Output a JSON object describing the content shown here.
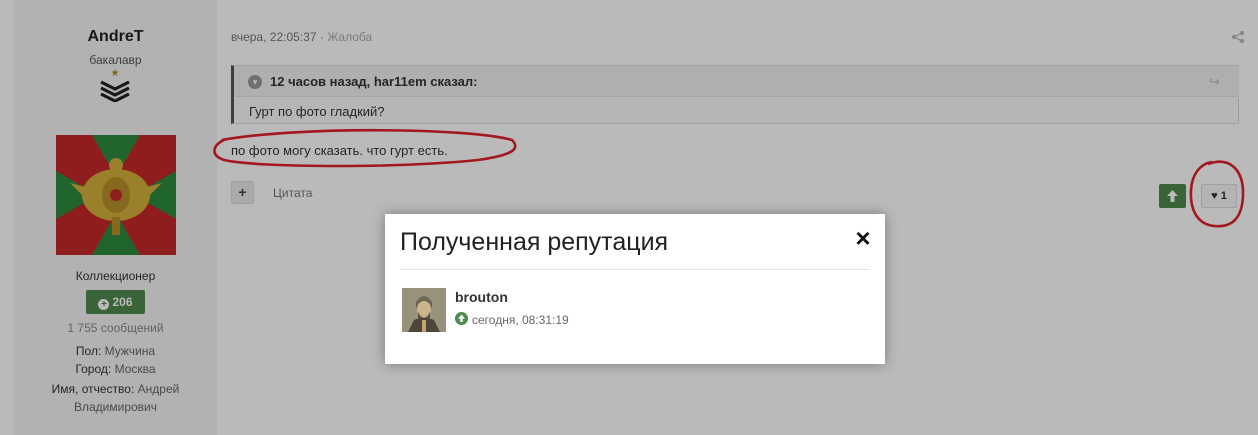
{
  "author": {
    "name": "AndreT",
    "rank": "бакалавр",
    "group": "Коллекционер",
    "reputation": "206",
    "posts": "1 755 сообщений",
    "fields": [
      {
        "label": "Пол:",
        "value": "Мужчина"
      },
      {
        "label": "Город:",
        "value": "Москва"
      },
      {
        "label": "Имя, отчество:",
        "value": "Андрей Владимирович"
      }
    ]
  },
  "post": {
    "date": "вчера, 22:05:37",
    "separator": "·",
    "report_label": "Жалоба",
    "quote": {
      "citation": "12 часов назад, har11em сказал:",
      "text": "Гурт по фото гладкий?"
    },
    "text": "по фото могу сказать. что гурт есть.",
    "multiquote_label": "+",
    "quote_label": "Цитата",
    "like_count": "1"
  },
  "modal": {
    "title": "Полученная репутация",
    "close_label": "×",
    "entries": [
      {
        "user": "brouton",
        "date": "сегодня, 08:31:19"
      }
    ]
  },
  "colors": {
    "accent_green": "#4d8a4d",
    "annotation_red": "#e0202a"
  }
}
